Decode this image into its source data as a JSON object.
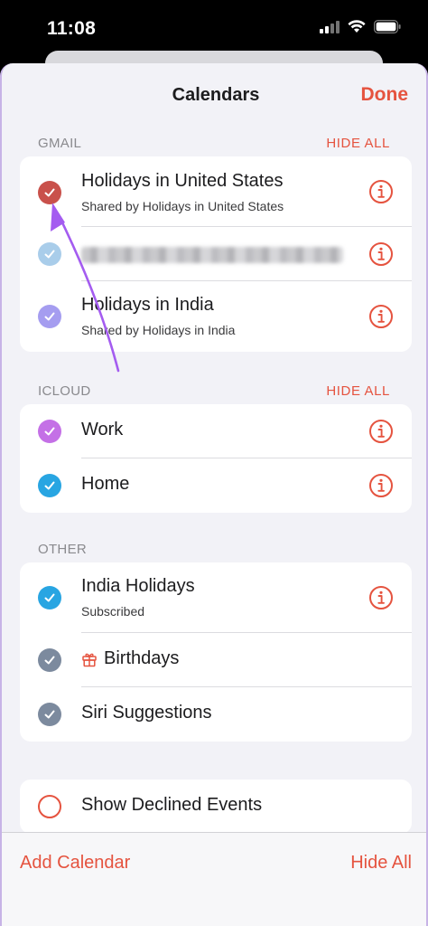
{
  "status_bar": {
    "time": "11:08"
  },
  "nav": {
    "title": "Calendars",
    "done_label": "Done"
  },
  "gmail": {
    "header": "GMAIL",
    "action": "HIDE ALL",
    "items": [
      {
        "title": "Holidays in United States",
        "subtitle": "Shared by Holidays in United States",
        "color": "#c9514b"
      },
      {
        "title": "",
        "subtitle": "",
        "color": "#a9cdea"
      },
      {
        "title": "Holidays in India",
        "subtitle": "Shared by Holidays in India",
        "color": "#a59df0"
      }
    ]
  },
  "icloud": {
    "header": "ICLOUD",
    "action": "HIDE ALL",
    "items": [
      {
        "title": "Work",
        "color": "#c470e6"
      },
      {
        "title": "Home",
        "color": "#28a5e2"
      }
    ]
  },
  "other": {
    "header": "OTHER",
    "items": [
      {
        "title": "India Holidays",
        "subtitle": "Subscribed",
        "color": "#28a5e2"
      },
      {
        "title": "Birthdays",
        "color": "#7c8a9e"
      },
      {
        "title": "Siri Suggestions",
        "color": "#7c8a9e"
      }
    ]
  },
  "declined": {
    "label": "Show Declined Events"
  },
  "bottom_bar": {
    "add_label": "Add Calendar",
    "hide_label": "Hide All"
  },
  "colors": {
    "accent": "#e5533f",
    "annotation_arrow": "#a45cf0"
  },
  "icons": {
    "info": "info-circle-icon",
    "check": "checkmark-icon",
    "gift": "gift-icon"
  }
}
